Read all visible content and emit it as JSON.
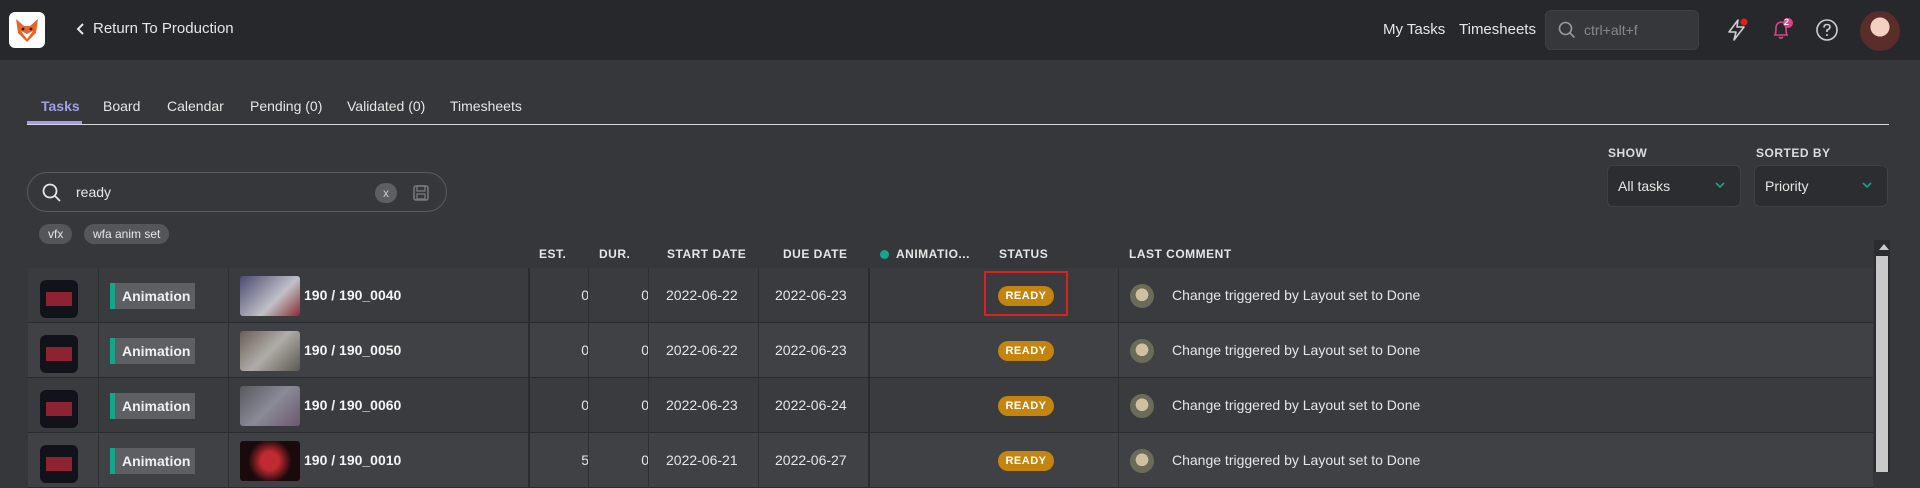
{
  "header": {
    "back_label": "Return To Production",
    "my_tasks": "My Tasks",
    "timesheets": "Timesheets",
    "search_placeholder": "ctrl+alt+f",
    "notification_count": "2"
  },
  "tabs": [
    {
      "label": "Tasks",
      "active": true
    },
    {
      "label": "Board"
    },
    {
      "label": "Calendar"
    },
    {
      "label": "Pending (0)"
    },
    {
      "label": "Validated (0)"
    },
    {
      "label": "Timesheets"
    }
  ],
  "filters": {
    "show_label": "SHOW",
    "show_value": "All tasks",
    "sorted_label": "SORTED BY",
    "sorted_value": "Priority"
  },
  "search": {
    "value": "ready",
    "clear": "x"
  },
  "chips": [
    "vfx",
    "wfa anim set"
  ],
  "columns": {
    "est": "EST.",
    "dur": "DUR.",
    "start": "START DATE",
    "due": "DUE DATE",
    "animation": "ANIMATIO...",
    "status": "STATUS",
    "last_comment": "LAST COMMENT"
  },
  "rows": [
    {
      "task_type": "Animation",
      "shot": "190 / 190_0040",
      "est": "0",
      "dur": "0",
      "start": "2022-06-22",
      "due": "2022-06-23",
      "status": "READY",
      "comment": "Change triggered by Layout set to Done"
    },
    {
      "task_type": "Animation",
      "shot": "190 / 190_0050",
      "est": "0",
      "dur": "0",
      "start": "2022-06-22",
      "due": "2022-06-23",
      "status": "READY",
      "comment": "Change triggered by Layout set to Done"
    },
    {
      "task_type": "Animation",
      "shot": "190 / 190_0060",
      "est": "0",
      "dur": "0",
      "start": "2022-06-23",
      "due": "2022-06-24",
      "status": "READY",
      "comment": "Change triggered by Layout set to Done"
    },
    {
      "task_type": "Animation",
      "shot": "190 / 190_0010",
      "est": "5",
      "dur": "0",
      "start": "2022-06-21",
      "due": "2022-06-27",
      "status": "READY",
      "comment": "Change triggered by Layout set to Done"
    }
  ],
  "colors": {
    "accent": "#9f9ee8",
    "status_ready": "#c4850f",
    "task_animation": "#17a589",
    "animation_dot": "#17a589"
  }
}
